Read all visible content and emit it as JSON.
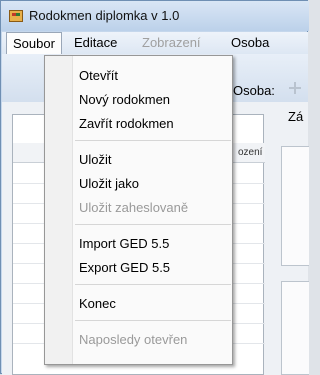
{
  "window": {
    "title": "Rodokmen diplomka v 1.0"
  },
  "menubar": {
    "items": [
      {
        "label": "Soubor"
      },
      {
        "label": "Editace"
      },
      {
        "label": "Zobrazení"
      },
      {
        "label": "Osoba"
      }
    ]
  },
  "toolbar": {
    "osoba_label": "Osoba:"
  },
  "grid": {
    "header_text": "ození"
  },
  "right_panel": {
    "label": "Zá"
  },
  "dropdown": {
    "items": [
      {
        "label": "Otevřít",
        "enabled": true
      },
      {
        "label": "Nový rodokmen",
        "enabled": true
      },
      {
        "label": "Zavřít rodokmen",
        "enabled": true
      },
      {
        "label": "Uložit",
        "enabled": true
      },
      {
        "label": "Uložit jako",
        "enabled": true
      },
      {
        "label": "Uložit zaheslovaně",
        "enabled": false
      },
      {
        "label": "Import GED 5.5",
        "enabled": true
      },
      {
        "label": "Export GED 5.5",
        "enabled": true
      },
      {
        "label": "Konec",
        "enabled": true
      },
      {
        "label": "Naposledy otevřen",
        "enabled": false
      }
    ]
  },
  "icons": {
    "app_icon": "app-icon",
    "add": "plus-icon"
  },
  "colors": {
    "titlebar": "#bcd1ea",
    "menubar": "#dde7f3",
    "dropdown_bg": "#fafafa",
    "disabled_text": "#9a9a9a"
  }
}
